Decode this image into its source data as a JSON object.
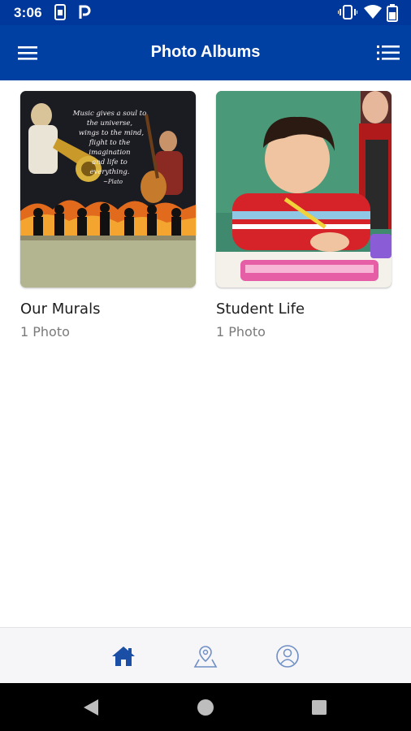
{
  "status_bar": {
    "time": "3:06",
    "left_icons": [
      "sim-card-icon",
      "parking-icon"
    ],
    "right_icons": [
      "vibrate-icon",
      "wifi-icon",
      "battery-icon"
    ]
  },
  "app_bar": {
    "title": "Photo Albums",
    "left_icon": "hamburger-menu-icon",
    "right_icon": "list-view-icon",
    "color": "#0040a3"
  },
  "albums": [
    {
      "title": "Our Murals",
      "count": "1 Photo",
      "mural_text": "Music gives a soul to the universe, wings to the mind, flight to the imagination and life to everything.",
      "mural_author": "Plato"
    },
    {
      "title": "Student Life",
      "count": "1 Photo"
    }
  ],
  "bottom_nav": {
    "items": [
      "home-icon",
      "map-pin-icon",
      "profile-icon"
    ],
    "active": "home-icon",
    "active_color": "#1b4ea5",
    "inactive_color": "#6f8fc4"
  },
  "system_nav": [
    "back-icon",
    "home-circle-icon",
    "recent-apps-icon"
  ]
}
